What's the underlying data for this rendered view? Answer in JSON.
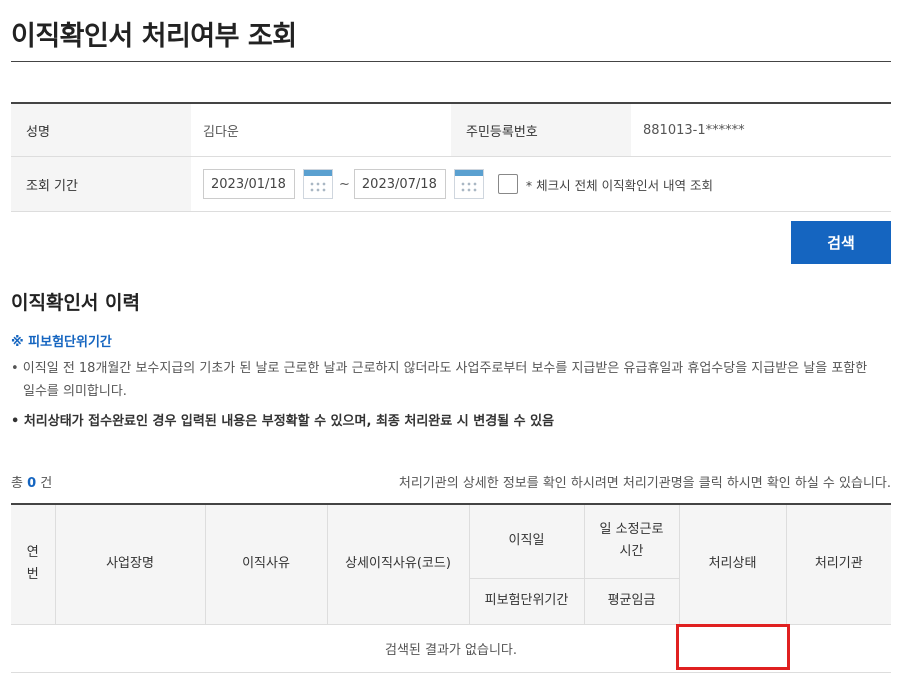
{
  "page": {
    "title": "이직확인서 처리여부 조회"
  },
  "form": {
    "name_label": "성명",
    "name_value": "김다운",
    "rrn_label": "주민등록번호",
    "rrn_value": "881013-1******",
    "period_label": "조회 기간",
    "start_date": "2023/01/18",
    "end_date": "2023/07/18",
    "separator": "~",
    "all_checkbox_label": "* 체크시 전체 이직확인서 내역 조회"
  },
  "search_button": "검색",
  "history": {
    "title": "이직확인서 이력",
    "note_heading": "※ 피보험단위기간",
    "note_1": "• 이직일 전 18개월간 보수지급의 기초가 된 날로 근로한 날과 근로하지 않더라도 사업주로부터 보수를 지급받은 유급휴일과 휴업수당을 지급받은 날을 포함한 일수를 의미합니다.",
    "note_2": "• 처리상태가 접수완료인 경우 입력된 내용은 부정확할 수 있으며, 최종 처리완료 시 변경될 수 있음",
    "count_prefix": "총",
    "count": "0",
    "count_suffix": "건",
    "info_text": "처리기관의 상세한 정보를 확인 하시려면 처리기관명을 클릭 하시면 확인 하실 수 있습니다."
  },
  "table": {
    "headers": {
      "no": "연번",
      "company": "사업장명",
      "reason": "이직사유",
      "reason_detail": "상세이직사유(코드)",
      "leave_date": "이직일",
      "work_hours": "일 소정근로시간",
      "status": "처리상태",
      "agency": "처리기관",
      "insured_period": "피보험단위기간",
      "avg_wage": "평균임금"
    },
    "empty_message": "검색된 결과가 없습니다."
  }
}
